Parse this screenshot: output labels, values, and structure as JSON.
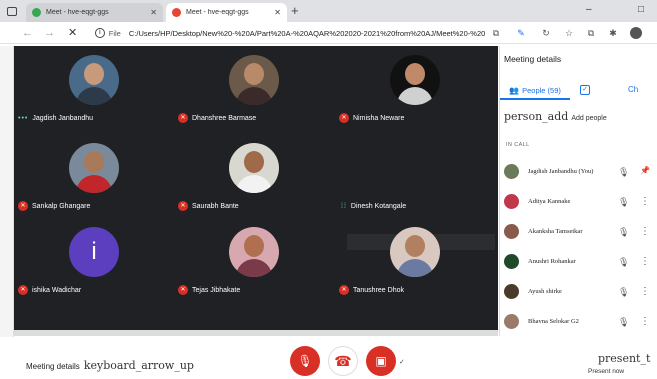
{
  "browser": {
    "tabs": [
      {
        "title": "Meet - hve-eqgt-ggs",
        "favicon_color": "#34a853"
      },
      {
        "title": "Meet - hve-eqgt-ggs",
        "favicon_color": "#ea4335"
      }
    ],
    "new_tab_glyph": "+",
    "window_controls": [
      "–",
      "□"
    ],
    "scheme_label": "File",
    "url": "C:/Users/HP/Desktop/New%20-%20A/Part%20A-%20AQAR%202020-2021%20from%20AJ/Meet%20-%20h...",
    "info_glyph": "i",
    "nav": {
      "back": "←",
      "forward": "→",
      "stop": "✕"
    },
    "extensions": [
      "read-aloud-icon",
      "pen-icon",
      "refresh-icon",
      "favorites-icon",
      "collections-icon",
      "extensions-icon",
      "profile-avatar"
    ]
  },
  "participants_grid": [
    {
      "name": "Jagdish Janbandhu",
      "status": "speaking",
      "avatar_colors": [
        "#4a6a8a",
        "#c69a7a",
        "#2d3a4a"
      ]
    },
    {
      "name": "Dhanshree Barmase",
      "status": "muted",
      "avatar_colors": [
        "#6b5a4a",
        "#b88a6a",
        "#3a2a2a"
      ]
    },
    {
      "name": "Nimisha Neware",
      "status": "muted",
      "avatar_colors": [
        "#111111",
        "#c08a6a",
        "#d0d0d0"
      ]
    },
    {
      "name": "Sankalp Ghangare",
      "status": "muted",
      "avatar_colors": [
        "#7a8a9a",
        "#a87a5a",
        "#c0262a"
      ]
    },
    {
      "name": "Saurabh Bante",
      "status": "muted",
      "avatar_colors": [
        "#d8d8d0",
        "#a06a4a",
        "#f2f2f2"
      ]
    },
    {
      "name": "Dinesh Kotangale",
      "status": "speaking",
      "avatar_colors": null
    },
    {
      "name": "ishika Wadichar",
      "status": "muted",
      "avatar_letter": "i"
    },
    {
      "name": "Tejas Jibhakate",
      "status": "muted",
      "avatar_colors": [
        "#d8a8b0",
        "#b07050",
        "#7a3a4a"
      ]
    },
    {
      "name": "Tanushree Dhok",
      "status": "muted",
      "avatar_colors": [
        "#d8c8c0",
        "#b08060",
        "#6a7aa0"
      ]
    }
  ],
  "panel": {
    "title": "Meeting details",
    "people_tab": "People (59)",
    "people_icon": "👥",
    "chat_tab": "Ch",
    "add_people_icon_text": "person_add",
    "add_people_label": "Add people",
    "in_call_header": "IN CALL",
    "people": [
      {
        "name": "Jagdish Janbandhu (You)",
        "avatar_color": "#6a7a5a",
        "action": "pin"
      },
      {
        "name": "Aditya Kannake",
        "avatar_color": "#c0384a",
        "action": "more"
      },
      {
        "name": "Akanksha Tamsetkar",
        "avatar_color": "#8a5a4a",
        "action": "more"
      },
      {
        "name": "Anushri Rohankar",
        "avatar_color": "#1e4a2a",
        "action": "more"
      },
      {
        "name": "Ayush shirke",
        "avatar_color": "#4a3a2a",
        "action": "more"
      },
      {
        "name": "Bhavna Selokar G2",
        "avatar_color": "#9a7a6a",
        "action": "more"
      }
    ]
  },
  "glyphs": {
    "mic_off": "✕",
    "mic_off_panel": "🎙",
    "more": "⋮",
    "pin": "📌",
    "speaking": "•••",
    "speaking_alt": "⁞⁞",
    "check": "✓"
  },
  "bottom": {
    "meeting_details": "Meeting details",
    "arrow_icon_text": "keyboard_arrow_up",
    "present_icon_text": "present_t",
    "present_label": "Present now",
    "mic_glyph": "🎙",
    "hangup_glyph": "☎",
    "cam_glyph": "▣"
  },
  "colors": {
    "accent": "#1a73e8",
    "danger": "#d93025",
    "stage": "#202124"
  }
}
